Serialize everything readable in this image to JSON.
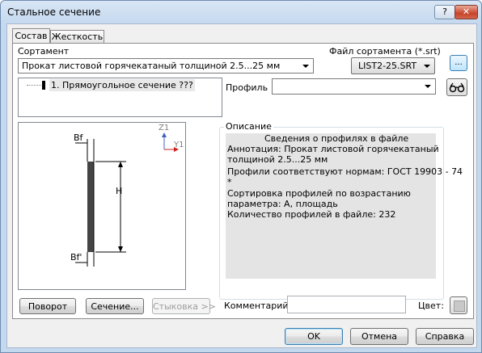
{
  "window": {
    "title": "Стальное сечение",
    "help_label": "?",
    "close_label": "✕"
  },
  "tabs": [
    {
      "label": "Состав",
      "active": true
    },
    {
      "label": "Жесткость",
      "active": false
    }
  ],
  "assortment": {
    "label": "Сортамент",
    "value": "Прокат  листовой  горячекатаный  толщиной 2.5...25 мм"
  },
  "assortment_file": {
    "label": "Файл сортамента (*.srt)",
    "value": "LIST2-25.SRT",
    "browse_label": "..."
  },
  "tree": {
    "items": [
      {
        "label": "1. Прямоугольное сечение ???"
      }
    ]
  },
  "profile": {
    "label": "Профиль",
    "value": ""
  },
  "diagram": {
    "label_bf_top": "Bf",
    "label_h": "H",
    "label_bf_bottom": "Bf'",
    "axis_z": "Z1",
    "axis_y": "Y1",
    "accent_color": "#cc2222"
  },
  "description": {
    "group_label": "Описание",
    "lines": [
      "Сведения о профилях в файле",
      "Аннотация: Прокат  листовой  горячекатаный",
      "толщиной 2.5...25 мм",
      "Профили соответствуют нормам: ГОСТ 19903 - 74",
      "*",
      "Сортировка профилей по возрастанию",
      "параметра: A, площадь",
      "Количество профилей в файле: 232"
    ]
  },
  "bottom": {
    "rotate_label": "Поворот",
    "section_label": "Сечение...",
    "joint_label": "Стыковка >>",
    "comment_label": "Комментарий:",
    "comment_value": "",
    "color_label": "Цвет:"
  },
  "dialog_buttons": {
    "ok": "OK",
    "cancel": "Отмена",
    "help": "Справка"
  }
}
